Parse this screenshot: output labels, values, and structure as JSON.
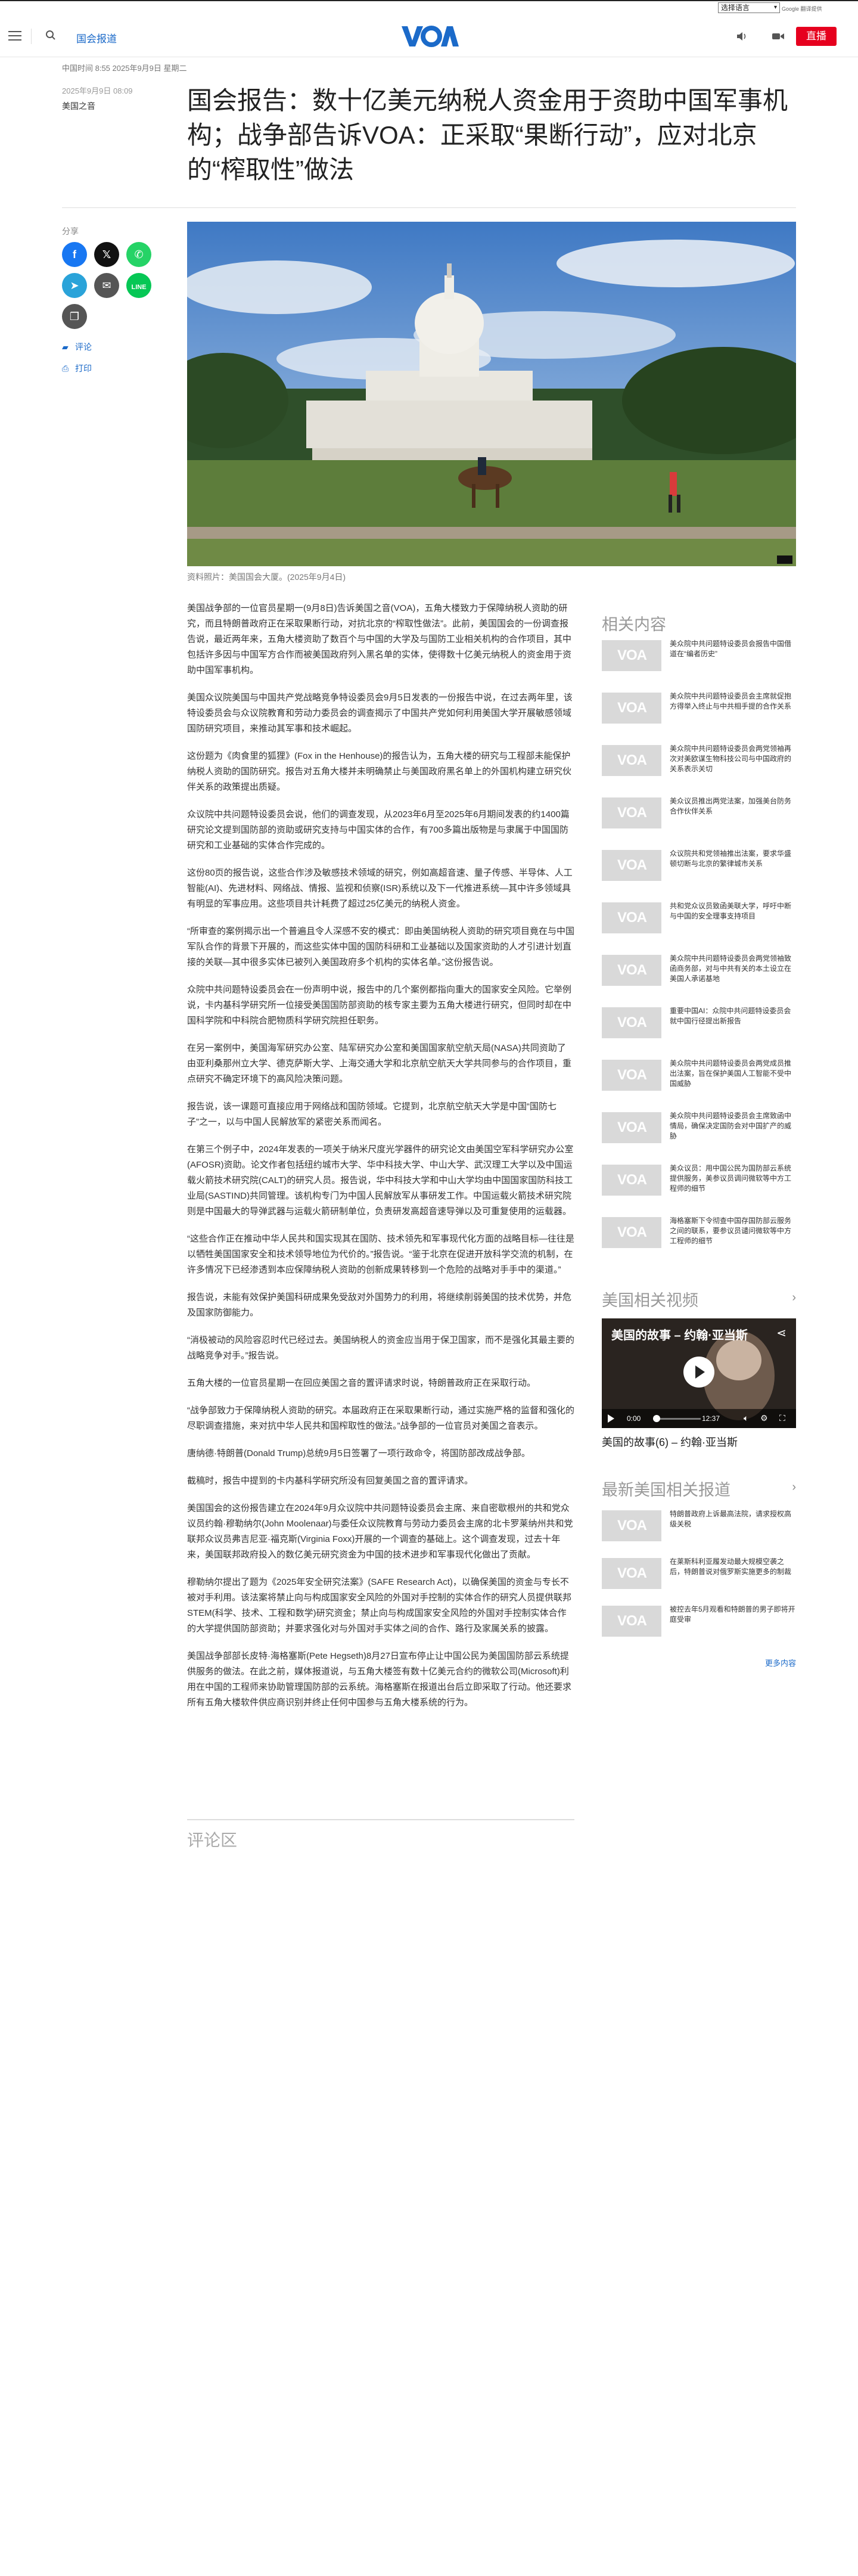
{
  "translate": {
    "select_label": "选择语言",
    "powered": "Google 翻译提供"
  },
  "header": {
    "section": "国会报道",
    "live_label": "直播"
  },
  "article": {
    "meta": "中国时间 8:55 2025年9月9日 星期二",
    "date": "2025年9月9日 08:09",
    "category": "美国之音",
    "headline": "国会报告：数十亿美元纳税人资金用于资助中国军事机构；战争部告诉VOA：正采取“果断行动”，应对北京的“榨取性”做法",
    "share_label": "分享",
    "comment_link": "评论",
    "print_link": "打印",
    "caption": "资料照片：美国国会大厦。(2025年9月4日)",
    "paragraphs": [
      "美国战争部的一位官员星期一(9月8日)告诉美国之音(VOA)，五角大楼致力于保障纳税人资助的研究，而且特朗普政府正在采取果断行动，对抗北京的“榨取性做法”。此前，美国国会的一份调查报告说，最近两年来，五角大楼资助了数百个与中国的大学及与国防工业相关机构的合作项目，其中包括许多因与中国军方合作而被美国政府列入黑名单的实体，使得数十亿美元纳税人的资金用于资助中国军事机构。",
      "美国众议院美国与中国共产党战略竞争特设委员会9月5日发表的一份报告中说，在过去两年里，该特设委员会与众议院教育和劳动力委员会的调查揭示了中国共产党如何利用美国大学开展敏感领域国防研究项目，来推动其军事和技术崛起。",
      "这份题为《肉食里的狐狸》(Fox in the Henhouse)的报告认为，五角大楼的研究与工程部未能保护纳税人资助的国防研究。报告对五角大楼并未明确禁止与美国政府黑名单上的外国机构建立研究伙伴关系的政策提出质疑。",
      "众议院中共问题特设委员会说，他们的调查发现，从2023年6月至2025年6月期间发表的约1400篇研究论文提到国防部的资助或研究支持与中国实体的合作，有700多篇出版物是与隶属于中国国防研究和工业基础的实体合作完成的。",
      "这份80页的报告说，这些合作涉及敏感技术领域的研究，例如高超音速、量子传感、半导体、人工智能(AI)、先进材料、网络战、情报、监视和侦察(ISR)系统以及下一代推进系统—其中许多领域具有明显的军事应用。这些项目共计耗费了超过25亿美元的纳税人资金。",
      "“所审查的案例揭示出一个普遍且令人深感不安的模式：即由美国纳税人资助的研究项目竟在与中国军队合作的背景下开展的，而这些实体中国的国防科研和工业基础以及国家资助的人才引进计划直接的关联—其中很多实体已被列入美国政府多个机构的实体名单。”这份报告说。",
      "众院中共问题特设委员会在一份声明中说，报告中的几个案例都指向重大的国家安全风险。它举例说，卡内基科学研究所一位接受美国国防部资助的核专家主要为五角大楼进行研究，但同时却在中国科学院和中科院合肥物质科学研究院担任职务。",
      "在另一案例中，美国海军研究办公室、陆军研究办公室和美国国家航空航天局(NASA)共同资助了由亚利桑那州立大学、德克萨斯大学、上海交通大学和北京航空航天大学共同参与的合作项目，重点研究不确定环境下的高风险决策问题。",
      "报告说，该一课题可直接应用于网络战和国防领域。它提到，北京航空航天大学是中国“国防七子”之一，以与中国人民解放军的紧密关系而闻名。",
      "在第三个例子中，2024年发表的一项关于纳米尺度光学器件的研究论文由美国空军科学研究办公室(AFOSR)资助。论文作者包括纽约城市大学、华中科技大学、中山大学、武汉理工大学以及中国运载火箭技术研究院(CALT)的研究人员。报告说，华中科技大学和中山大学均由中国国家国防科技工业局(SASTIND)共同管理。该机构专门为中国人民解放军从事研发工作。中国运载火箭技术研究院则是中国最大的导弹武器与运载火箭研制单位，负责研发高超音速导弹以及可重复使用的运载器。",
      "“这些合作正在推动中华人民共和国实现其在国防、技术领先和军事现代化方面的战略目标—往往是以牺牲美国国家安全和技术领导地位为代价的。”报告说。“鉴于北京在促进开放科学交流的机制，在许多情况下已经渗透到本应保障纳税人资助的创新成果转移到一个危险的战略对手手中的渠道。”",
      "报告说，未能有效保护美国科研成果免受敌对外国势力的利用，将继续削弱美国的技术优势，并危及国家防御能力。",
      "“消极被动的风险容忍时代已经过去。美国纳税人的资金应当用于保卫国家，而不是强化其最主要的战略竞争对手。”报告说。",
      "五角大楼的一位官员星期一在回应美国之音的置评请求时说，特朗普政府正在采取行动。",
      "“战争部致力于保障纳税人资助的研究。本届政府正在采取果断行动，通过实施严格的监督和强化的尽职调查措施，来对抗中华人民共和国榨取性的做法。”战争部的一位官员对美国之音表示。",
      "唐纳德·特朗普(Donald Trump)总统9月5日签署了一项行政命令，将国防部改成战争部。",
      "截稿时，报告中提到的卡内基科学研究所没有回复美国之音的置评请求。",
      "美国国会的这份报告建立在2024年9月众议院中共问题特设委员会主席、来自密歇根州的共和党众议员约翰·穆勒纳尔(John Moolenaar)与委任众议院教育与劳动力委员会主席的北卡罗莱纳州共和党联邦众议员弗吉尼亚·福克斯(Virginia Foxx)开展的一个调查的基础上。这个调查发现，过去十年来，美国联邦政府投入的数亿美元研究资金为中国的技术进步和军事现代化做出了贡献。",
      "穆勒纳尔提出了题为《2025年安全研究法案》(SAFE Research Act)，以确保美国的资金与专长不被对手利用。该法案将禁止向与构成国家安全风险的外国对手控制的实体合作的研究人员提供联邦STEM(科学、技术、工程和数学)研究资金；禁止向与构成国家安全风险的外国对手控制实体合作的大学提供国防部资助；并要求强化对与外国对手实体之间的合作、路行及家属关系的披露。",
      "美国战争部部长皮特·海格塞斯(Pete Hegseth)8月27日宣布停止让中国公民为美国国防部云系统提供服务的做法。在此之前，媒体报道说，与五角大楼签有数十亿美元合约的微软公司(Microsoft)利用在中国的工程师来协助管理国防部的云系统。海格塞斯在报道出台后立即采取了行动。他还要求所有五角大楼软件供应商识别并终止任何中国参与五角大楼系统的行为。"
    ],
    "comments_title": "评论区"
  },
  "sidebar": {
    "related_title": "相关内容",
    "related": [
      "美众院中共问题特设委员会报告中国借道在“编者历史”",
      "美众院中共问题特设委员会主席就促抱方得举入终止与中共相手提的合作关系",
      "美众院中共问题特设委员会两党领袖再次对美欧谋生物科技公司与中国政府的关系表示关切",
      "美众议员推出两党法案，加强美台防务合作伙伴关系",
      "众议院共和党领袖推出法案，要求华盛顿切断与北京的繁律城市关系",
      "共和党众议员致函美联大学，呼吁中断与中国的安全理事支持项目",
      "美众院中共问题特设委员会两党领袖致函商务部，对与中共有关的本土设立在美国人承诺基地",
      "重要中国AI：众院中共问题特设委员会就中国行径提出新报告",
      "美众院中共问题特设委员会两党成员推出法案，旨在保护美国人工智能不受中国威胁",
      "美众院中共问题特设委员会主席致函中情局，确保决定国防会对中国扩产的威胁",
      "美众议员：用中国公民为国防部云系统提供服务，美参议员调问微软等中方工程师的细节",
      "海格塞斯下令彻查中国存国防部云服务之间的联系，要参议员谴问微软等中方工程师的细节"
    ],
    "video_title": "美国相关视频",
    "video_overlay_title": "美国的故事 – 约翰·亚当斯",
    "video_time": "0:00",
    "video_duration": "12:37",
    "video_caption": "美国的故事(6) – 约翰·亚当斯",
    "latest_title": "最新美国相关报道",
    "latest": [
      "特朗普政府上诉最高法院，请求授权高级关税",
      "在莱斯科利亚履发动最大规模空袭之后，特朗普说对俄罗斯实施更多的制裁",
      "被控去年5月观看和特朗普的男子即将开庭受审"
    ],
    "more_label": "更多内容"
  },
  "colors": {
    "accent_blue": "#1b6ac9",
    "live_red": "#e6001e",
    "facebook": "#1877f2",
    "x": "#111111",
    "whatsapp": "#25d366",
    "telegram": "#2aa3d9",
    "email": "#555555",
    "line": "#06c755",
    "copy": "#555555"
  }
}
